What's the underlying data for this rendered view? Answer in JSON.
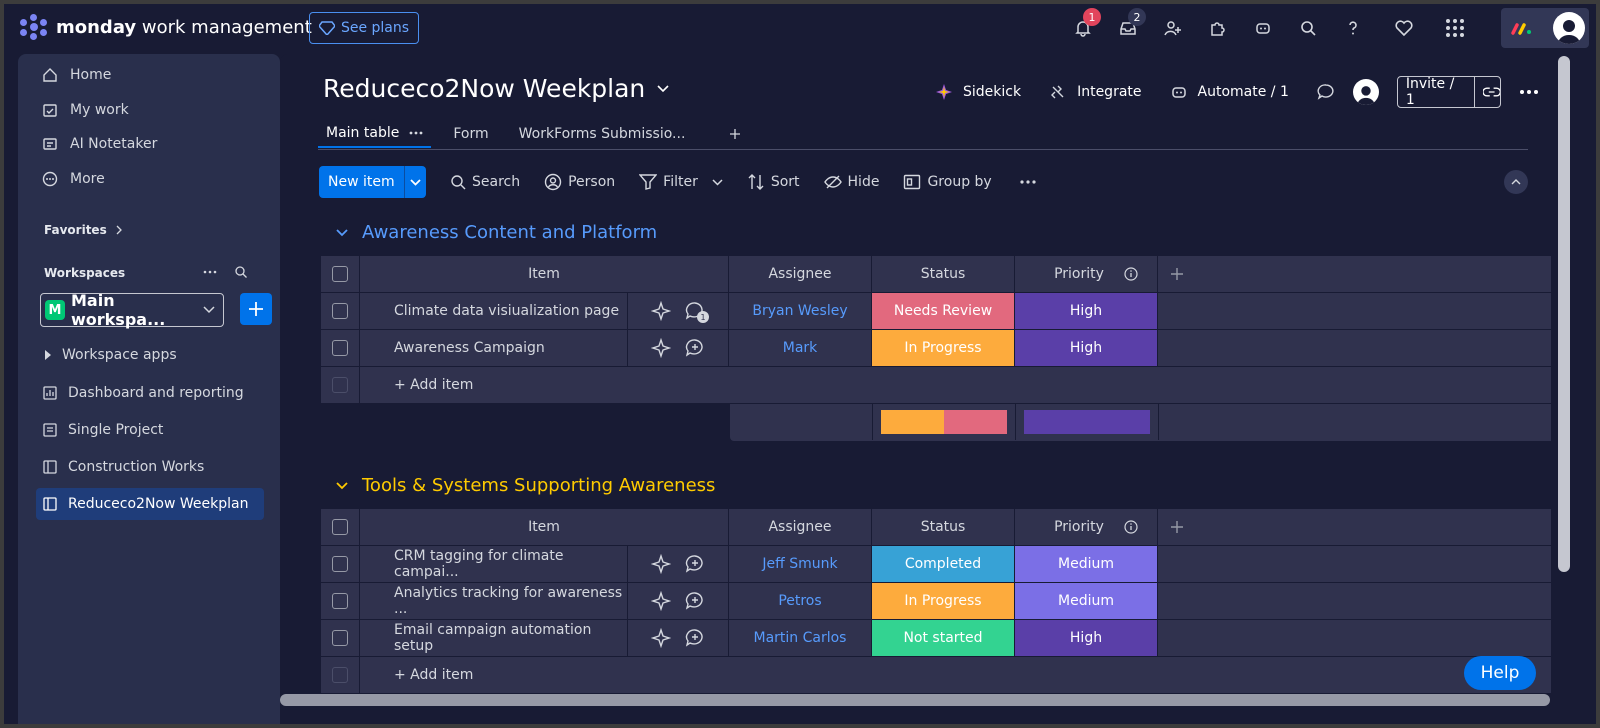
{
  "brand": {
    "bold": "monday",
    "light": "work management"
  },
  "top": {
    "see_plans": "See plans",
    "notif_count": "1",
    "inbox_count": "2"
  },
  "sidebar": {
    "nav": [
      "Home",
      "My work",
      "AI Notetaker",
      "More"
    ],
    "favorites": "Favorites",
    "workspaces": "Workspaces",
    "workspace_name": "Main workspa...",
    "workspace_initial": "M",
    "workspace_apps": "Workspace apps",
    "items": [
      "Dashboard and reporting",
      "Single Project",
      "Construction Works",
      "Reduceco2Now Weekplan"
    ]
  },
  "board": {
    "title": "Reduceco2Now Weekplan",
    "actions": {
      "sidekick": "Sidekick",
      "integrate": "Integrate",
      "automate": "Automate / 1",
      "invite": "Invite / 1"
    },
    "tabs": [
      "Main table",
      "Form",
      "WorkForms Submissio..."
    ],
    "toolbar": {
      "new_item": "New item",
      "search": "Search",
      "person": "Person",
      "filter": "Filter",
      "sort": "Sort",
      "hide": "Hide",
      "group_by": "Group by"
    },
    "columns": {
      "item": "Item",
      "assignee": "Assignee",
      "status": "Status",
      "priority": "Priority"
    },
    "add_item": "+ Add item",
    "groups": [
      {
        "title": "Awareness Content and Platform",
        "color": "#579bfc",
        "rows": [
          {
            "item": "Climate data visiualization page",
            "assignee": "Bryan Wesley",
            "status": "Needs Review",
            "status_color": "#e2697e",
            "priority": "High",
            "priority_color": "#5a3fa8",
            "updates": "1"
          },
          {
            "item": "Awareness Campaign",
            "assignee": "Mark",
            "status": "In Progress",
            "status_color": "#fdab3d",
            "priority": "High",
            "priority_color": "#5a3fa8"
          }
        ]
      },
      {
        "title": "Tools & Systems Supporting Awareness",
        "color": "#ffcb00",
        "rows": [
          {
            "item": "CRM tagging for climate campai...",
            "assignee": "Jeff Smunk",
            "status": "Completed",
            "status_color": "#37a2d6",
            "priority": "Medium",
            "priority_color": "#7b6fe6"
          },
          {
            "item": "Analytics tracking for awareness ...",
            "assignee": "Petros",
            "status": "In Progress",
            "status_color": "#fdab3d",
            "priority": "Medium",
            "priority_color": "#7b6fe6"
          },
          {
            "item": "Email campaign automation setup",
            "assignee": "Martin Carlos",
            "status": "Not started",
            "status_color": "#33d391",
            "priority": "High",
            "priority_color": "#5a3fa8"
          }
        ]
      }
    ]
  },
  "help": "Help"
}
